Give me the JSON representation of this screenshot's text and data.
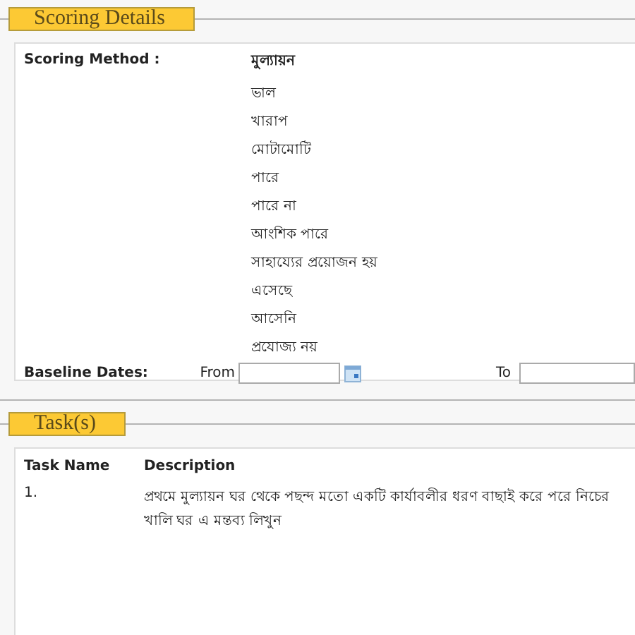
{
  "scoring_details": {
    "title": "Scoring Details",
    "scoring_method": {
      "label": "Scoring Method :",
      "heading": "মুল্যায়ন",
      "options": [
        "ভাল",
        "খারাপ",
        "মোটামোটি",
        "পারে",
        "পারে না",
        "আংশিক পারে",
        "সাহায্যের প্রয়োজন হয়",
        "এসেছে",
        "আসেনি",
        "প্রযোজ্য নয়"
      ]
    },
    "baseline_dates": {
      "label": "Baseline Dates:",
      "from_label": "From",
      "to_label": "To"
    }
  },
  "tasks": {
    "title": "Task(s)",
    "columns": [
      "Task Name",
      "Description"
    ],
    "rows": [
      {
        "task_name": "1.",
        "description": "প্রথমে মুল্যায়ন ঘর থেকে পছন্দ মতো একটি কার্যাবলীর ধরণ বাছাই করে পরে নিচের খালি ঘর এ মন্তব্য লিখুন"
      }
    ]
  }
}
